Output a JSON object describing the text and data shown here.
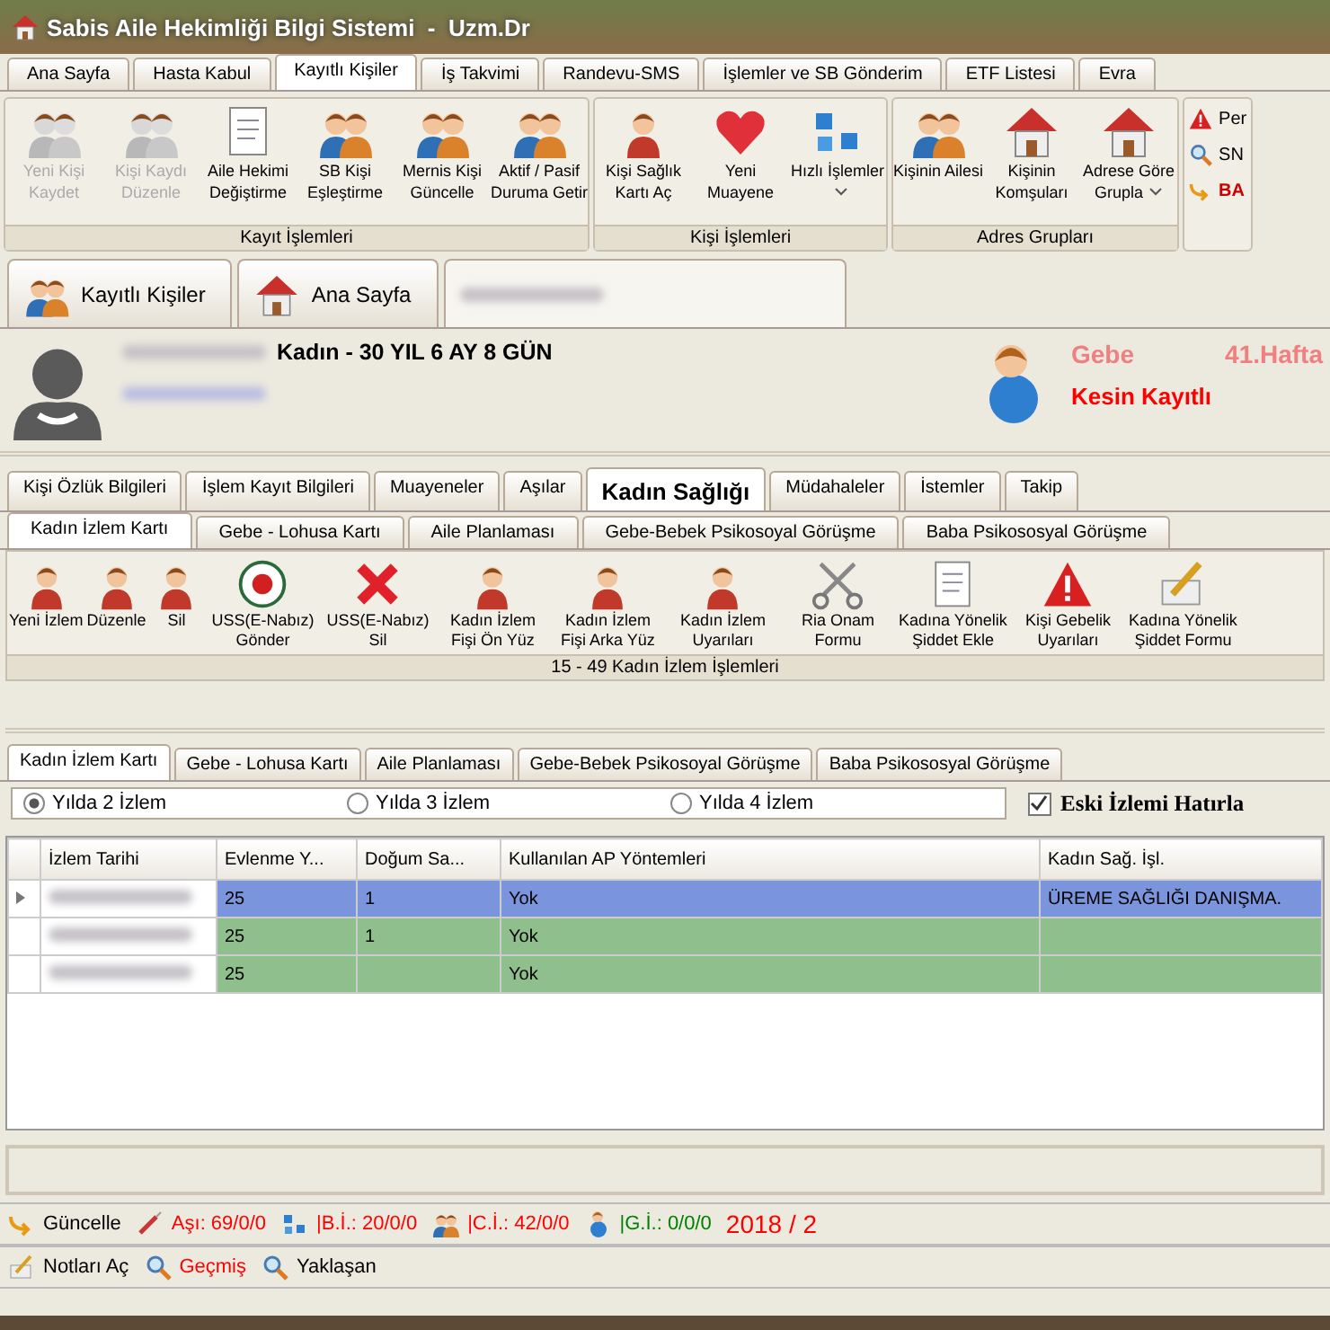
{
  "window": {
    "title": "Sabis Aile Hekimliği Bilgi Sistemi  -  Uzm.Dr"
  },
  "main_tabs": [
    {
      "label": "Ana Sayfa",
      "selected": false
    },
    {
      "label": "Hasta Kabul",
      "selected": false
    },
    {
      "label": "Kayıtlı Kişiler",
      "selected": true
    },
    {
      "label": "İş Takvimi",
      "selected": false
    },
    {
      "label": "Randevu-SMS",
      "selected": false
    },
    {
      "label": "İşlemler ve SB Gönderim",
      "selected": false
    },
    {
      "label": "ETF Listesi",
      "selected": false
    },
    {
      "label": "Evra",
      "selected": false
    }
  ],
  "ribbon_groups": [
    {
      "title": "Kayıt İşlemleri",
      "buttons": [
        {
          "label": "Yeni Kişi Kaydet",
          "disabled": true
        },
        {
          "label": "Kişi Kaydı Düzenle",
          "disabled": true
        },
        {
          "label": "Aile Hekimi Değiştirme",
          "disabled": false
        },
        {
          "label": "SB Kişi Eşleştirme",
          "disabled": false
        },
        {
          "label": "Mernis Kişi Güncelle",
          "disabled": false
        },
        {
          "label": "Aktif / Pasif Duruma Getir",
          "disabled": false
        }
      ]
    },
    {
      "title": "Kişi İşlemleri",
      "buttons": [
        {
          "label": "Kişi Sağlık Kartı Aç",
          "disabled": false
        },
        {
          "label": "Yeni Muayene",
          "disabled": false
        },
        {
          "label": "Hızlı İşlemler",
          "disabled": false,
          "has_menu": true
        }
      ]
    },
    {
      "title": "Adres Grupları",
      "buttons": [
        {
          "label": "Kişinin Ailesi",
          "disabled": false
        },
        {
          "label": "Kişinin Komşuları",
          "disabled": false
        },
        {
          "label": "Adrese Göre Grupla",
          "disabled": false,
          "has_menu": true
        }
      ]
    }
  ],
  "ribbon_side": [
    {
      "label": "Per"
    },
    {
      "label": "SN"
    },
    {
      "label": "BA"
    }
  ],
  "doc_tabs": [
    {
      "label": "Kayıtlı Kişiler",
      "selected": false
    },
    {
      "label": "Ana Sayfa",
      "selected": false
    },
    {
      "selected": true
    }
  ],
  "patient": {
    "sex_age": "Kadın - 30 YIL 6 AY 8 GÜN",
    "status": "Gebe",
    "week": "41.Hafta",
    "registration": "Kesin Kayıtlı"
  },
  "patient_tabs": [
    {
      "label": "Kişi Özlük Bilgileri",
      "selected": false
    },
    {
      "label": "İşlem Kayıt Bilgileri",
      "selected": false
    },
    {
      "label": "Muayeneler",
      "selected": false
    },
    {
      "label": "Aşılar",
      "selected": false
    },
    {
      "label": "Kadın Sağlığı",
      "selected": true
    },
    {
      "label": "Müdahaleler",
      "selected": false
    },
    {
      "label": "İstemler",
      "selected": false
    },
    {
      "label": "Takip",
      "selected": false
    }
  ],
  "sub_tabs": [
    {
      "label": "Kadın İzlem Kartı",
      "selected": true
    },
    {
      "label": "Gebe - Lohusa Kartı",
      "selected": false
    },
    {
      "label": "Aile Planlaması",
      "selected": false
    },
    {
      "label": "Gebe-Bebek Psikosoyal Görüşme",
      "selected": false
    },
    {
      "label": "Baba Psikososyal Görüşme",
      "selected": false
    }
  ],
  "tools": {
    "title": "15 - 49 Kadın İzlem İşlemleri",
    "buttons": [
      "Yeni İzlem",
      "Düzenle",
      "Sil",
      "USS(E-Nabız) Gönder",
      "USS(E-Nabız) Sil",
      "Kadın İzlem Fişi Ön Yüz",
      "Kadın İzlem Fişi Arka Yüz",
      "Kadın İzlem Uyarıları",
      "Ria Onam Formu",
      "Kadına Yönelik Şiddet Ekle",
      "Kişi Gebelik Uyarıları",
      "Kadına Yönelik Şiddet Formu"
    ]
  },
  "lower_tabs": [
    {
      "label": "Kadın İzlem Kartı",
      "selected": true
    },
    {
      "label": "Gebe - Lohusa Kartı",
      "selected": false
    },
    {
      "label": "Aile Planlaması",
      "selected": false
    },
    {
      "label": "Gebe-Bebek Psikosoyal Görüşme",
      "selected": false
    },
    {
      "label": "Baba Psikososyal Görüşme",
      "selected": false
    }
  ],
  "frequency": [
    {
      "label": "Yılda 2 İzlem",
      "selected": true
    },
    {
      "label": "Yılda 3 İzlem",
      "selected": false
    },
    {
      "label": "Yılda 4 İzlem",
      "selected": false
    }
  ],
  "remember": {
    "label": "Eski İzlemi Hatırla",
    "checked": true
  },
  "table": {
    "columns": [
      "İzlem Tarihi",
      "Evlenme Y...",
      "Doğum Sa...",
      "Kullanılan AP Yöntemleri",
      "Kadın Sağ. İşl."
    ],
    "rows": [
      {
        "selected": true,
        "cells": [
          "",
          "25",
          "1",
          "Yok",
          "ÜREME SAĞLIĞI DANIŞMA."
        ]
      },
      {
        "selected": false,
        "cells": [
          "",
          "25",
          "1",
          "Yok",
          ""
        ]
      },
      {
        "selected": false,
        "cells": [
          "",
          "25",
          "",
          "Yok",
          ""
        ]
      }
    ]
  },
  "status_bar": [
    {
      "label": "Güncelle",
      "color": "#000000"
    },
    {
      "label": "Aşı: 69/0/0",
      "color": "#ff0000"
    },
    {
      "label": "|B.İ.: 20/0/0",
      "color": "#ff0000"
    },
    {
      "label": "|C.İ.: 42/0/0",
      "color": "#ff0000"
    },
    {
      "label": "|G.İ.: 0/0/0",
      "color": "#008000"
    },
    {
      "label": "2018 / 2",
      "color": "#ff0000"
    }
  ],
  "bottom_links": [
    {
      "label": "Notları Aç",
      "color": "#000000"
    },
    {
      "label": "Geçmiş",
      "color": "#ff0000"
    },
    {
      "label": "Yaklaşan",
      "color": "#000000"
    }
  ]
}
